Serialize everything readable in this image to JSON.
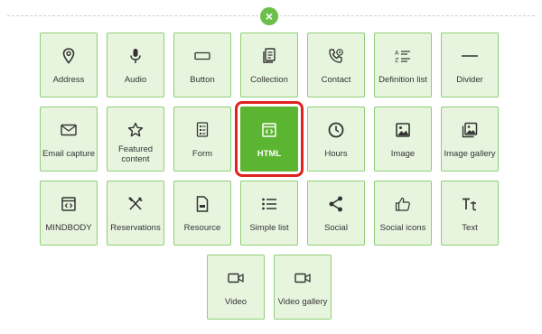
{
  "close_icon": "×",
  "tiles": {
    "address": "Address",
    "audio": "Audio",
    "button": "Button",
    "collection": "Collection",
    "contact": "Contact",
    "definition_list": "Definition list",
    "divider": "Divider",
    "email_capture": "Email capture",
    "featured_content": "Featured content",
    "form": "Form",
    "html": "HTML",
    "hours": "Hours",
    "image": "Image",
    "image_gallery": "Image gallery",
    "mindbody": "MINDBODY",
    "reservations": "Reservations",
    "resource": "Resource",
    "simple_list": "Simple list",
    "social": "Social",
    "social_icons": "Social icons",
    "text": "Text",
    "video": "Video",
    "video_gallery": "Video gallery"
  },
  "selected_tile": "HTML",
  "colors": {
    "tile_bg": "#e7f5df",
    "tile_border": "#8fcf76",
    "selected_bg": "#5cb531",
    "selection_outline": "#e0221e"
  }
}
